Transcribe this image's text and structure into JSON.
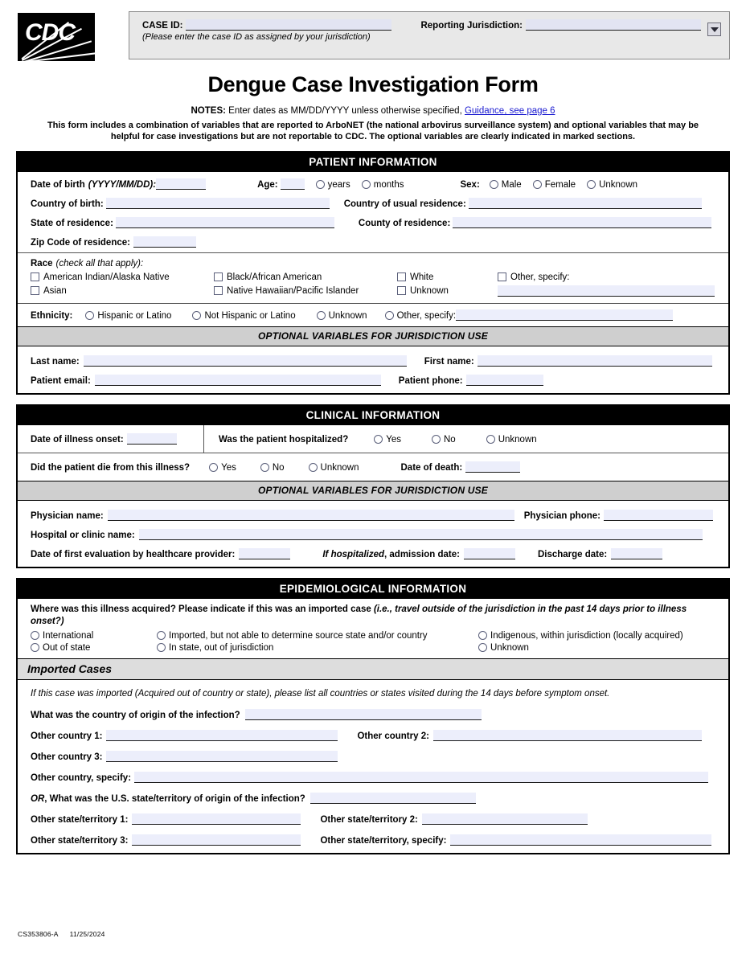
{
  "header": {
    "case_id_label": "CASE ID:",
    "case_id_value": "",
    "case_id_note": "(Please enter the case ID as assigned by your jurisdiction)",
    "jurisdiction_label": "Reporting Jurisdiction:",
    "jurisdiction_value": "",
    "logo_text": "CDC",
    "logo_tm": "®"
  },
  "title": "Dengue Case Investigation Form",
  "notes": {
    "label": "NOTES:",
    "text": " Enter dates as MM/DD/YYYY unless otherwise specified, ",
    "link": "Guidance, see page 6",
    "body": "This form includes a combination of variables that are reported to ArboNET (the national arbovirus surveillance system) and optional variables that may be helpful for case investigations but are not reportable to CDC. The optional variables are clearly indicated in marked sections."
  },
  "patient": {
    "section_title": "PATIENT INFORMATION",
    "dob_label": "Date of birth",
    "dob_format": "(YYYY/MM/DD):",
    "dob_value": "",
    "age_label": "Age:",
    "age_value": "",
    "age_units": [
      "years",
      "months"
    ],
    "sex_label": "Sex:",
    "sex_options": [
      "Male",
      "Female",
      "Unknown"
    ],
    "country_birth_label": "Country of birth:",
    "country_birth_value": "",
    "country_residence_label": "Country of usual residence:",
    "country_residence_value": "",
    "state_residence_label": "State of residence:",
    "state_residence_value": "",
    "county_residence_label": "County of residence:",
    "county_residence_value": "",
    "zip_label": "Zip Code of residence:",
    "zip_value": "",
    "race_label": "Race",
    "race_hint": "(check all that apply):",
    "race_options": [
      "American Indian/Alaska Native",
      "Black/African American",
      "White",
      "Other, specify:",
      "Asian",
      "Native Hawaiian/Pacific Islander",
      "Unknown"
    ],
    "race_other_value": "",
    "ethnicity_label": "Ethnicity:",
    "ethnicity_options": [
      "Hispanic or Latino",
      "Not Hispanic or Latino",
      "Unknown",
      "Other, specify:"
    ],
    "ethnicity_other_value": "",
    "optional_bar": "OPTIONAL VARIABLES FOR JURISDICTION USE",
    "last_name_label": "Last name:",
    "last_name_value": "",
    "first_name_label": "First name:",
    "first_name_value": "",
    "email_label": "Patient email:",
    "email_value": "",
    "phone_label": "Patient phone:",
    "phone_value": ""
  },
  "clinical": {
    "section_title": "CLINICAL INFORMATION",
    "onset_label": "Date of illness onset:",
    "onset_value": "",
    "hospitalized_label": "Was the patient hospitalized?",
    "hospitalized_options": [
      "Yes",
      "No",
      "Unknown"
    ],
    "died_label": "Did the patient die from this illness?",
    "died_options": [
      "Yes",
      "No",
      "Unknown"
    ],
    "death_date_label": "Date of death:",
    "death_date_value": "",
    "optional_bar": "OPTIONAL VARIABLES FOR JURISDICTION USE",
    "physician_name_label": "Physician name:",
    "physician_name_value": "",
    "physician_phone_label": "Physician phone:",
    "physician_phone_value": "",
    "hospital_label": "Hospital or clinic name:",
    "hospital_value": "",
    "first_eval_label": "Date of first evaluation by healthcare provider:",
    "first_eval_value": "",
    "if_hospitalized_label": "If hospitalized",
    "admission_label": ", admission date:",
    "admission_value": "",
    "discharge_label": "Discharge date:",
    "discharge_value": ""
  },
  "epi": {
    "section_title": "EPIDEMIOLOGICAL INFORMATION",
    "question_bold": "Where was this illness acquired? Please indicate if this was an imported case ",
    "question_italic": "(i.e., travel outside of the jurisdiction in the past 14 days prior to illness onset?)",
    "options": [
      "International",
      "Imported, but not able to determine source state and/or country",
      "Indigenous, within jurisdiction (locally acquired)",
      "Out of state",
      "In state, out of jurisdiction",
      "Unknown"
    ],
    "imported_bar": "Imported Cases",
    "imported_note": "If this case was imported (Acquired out of country or state), please list all countries or states visited during the 14 days before symptom onset.",
    "origin_country_label": "What was the country of origin of the infection?",
    "origin_country_value": "",
    "other_country_1_label": "Other country 1:",
    "other_country_1_value": "",
    "other_country_2_label": "Other country 2:",
    "other_country_2_value": "",
    "other_country_3_label": "Other country 3:",
    "other_country_3_value": "",
    "other_country_specify_label": "Other country, specify:",
    "other_country_specify_value": "",
    "or_label": "OR",
    "or_state_label": ", What was the U.S. state/territory of origin of the infection?",
    "or_state_value": "",
    "other_state_1_label": "Other state/territory 1:",
    "other_state_1_value": "",
    "other_state_2_label": "Other state/territory 2:",
    "other_state_2_value": "",
    "other_state_3_label": "Other state/territory 3:",
    "other_state_3_value": "",
    "other_state_specify_label": "Other state/territory, specify:",
    "other_state_specify_value": ""
  },
  "footer": {
    "doc_id": "CS353806-A",
    "date": "11/25/2024"
  }
}
